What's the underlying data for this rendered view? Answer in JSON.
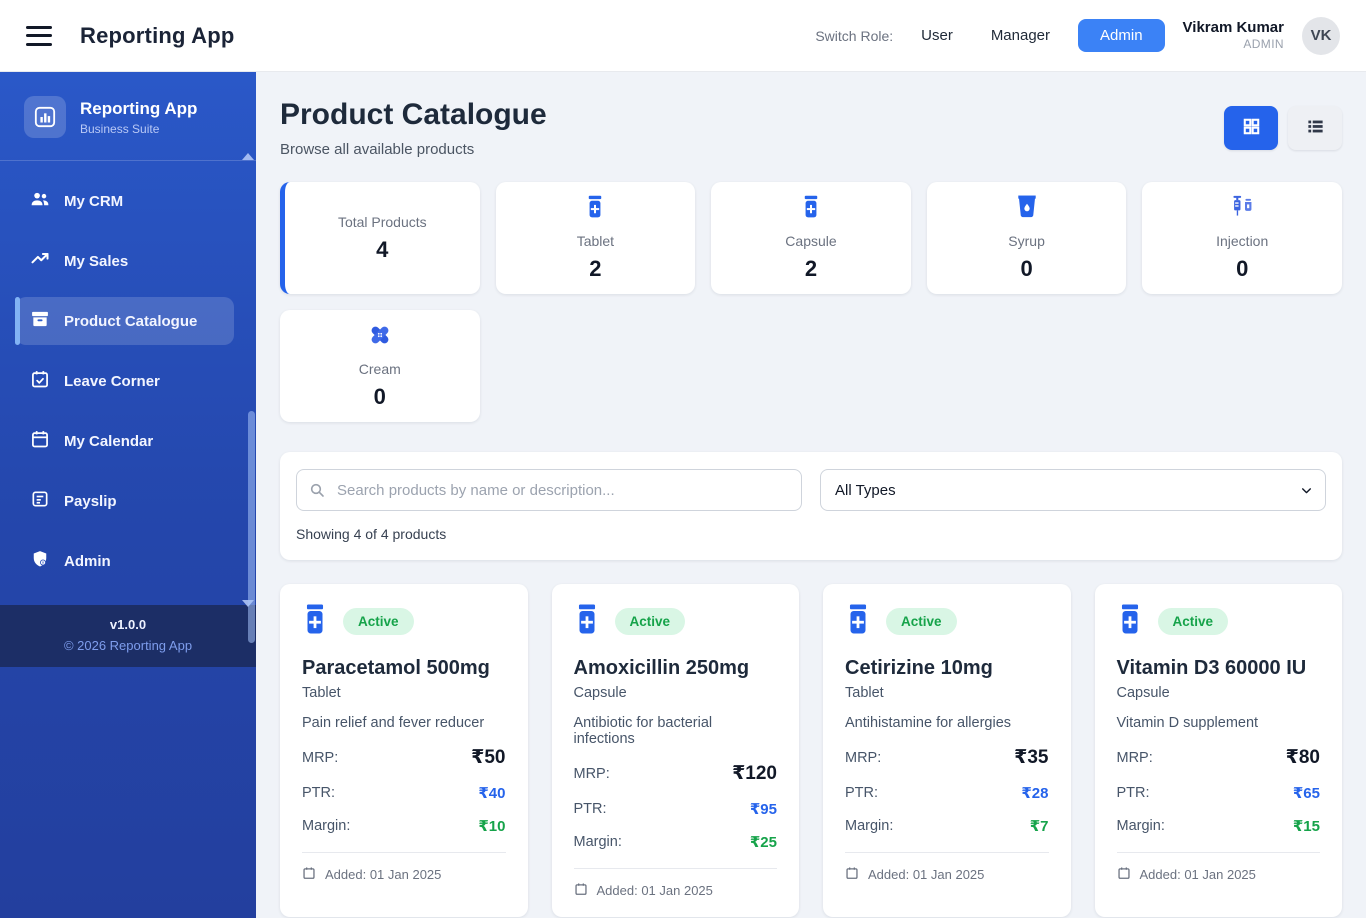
{
  "header": {
    "app_title": "Reporting App",
    "switch_role_label": "Switch Role:",
    "roles": [
      {
        "label": "User",
        "active": false
      },
      {
        "label": "Manager",
        "active": false
      },
      {
        "label": "Admin",
        "active": true
      }
    ],
    "user": {
      "name": "Vikram Kumar",
      "role": "ADMIN",
      "initials": "VK"
    }
  },
  "sidebar": {
    "brand": {
      "title": "Reporting App",
      "subtitle": "Business Suite",
      "logo_icon": "bar-chart-icon"
    },
    "items": [
      {
        "label": "My CRM",
        "icon": "users-icon",
        "active": false
      },
      {
        "label": "My Sales",
        "icon": "trending-up-icon",
        "active": false
      },
      {
        "label": "Product Catalogue",
        "icon": "archive-box-icon",
        "active": true
      },
      {
        "label": "Leave Corner",
        "icon": "calendar-check-icon",
        "active": false
      },
      {
        "label": "My Calendar",
        "icon": "calendar-icon",
        "active": false
      },
      {
        "label": "Payslip",
        "icon": "receipt-icon",
        "active": false
      },
      {
        "label": "Admin",
        "icon": "admin-shield-icon",
        "active": false
      }
    ],
    "footer": {
      "version": "v1.0.0",
      "copyright": "© 2026 Reporting App"
    }
  },
  "page": {
    "title": "Product Catalogue",
    "subtitle": "Browse all available products",
    "view_modes": [
      "grid",
      "list"
    ],
    "active_view": "grid"
  },
  "stats": [
    {
      "label": "Total Products",
      "value": "4",
      "icon": null,
      "selected": true
    },
    {
      "label": "Tablet",
      "value": "2",
      "icon": "pill-bottle-icon"
    },
    {
      "label": "Capsule",
      "value": "2",
      "icon": "pill-bottle-icon"
    },
    {
      "label": "Syrup",
      "value": "0",
      "icon": "syrup-cup-icon"
    },
    {
      "label": "Injection",
      "value": "0",
      "icon": "syringe-icon"
    },
    {
      "label": "Cream",
      "value": "0",
      "icon": "bandage-icon"
    }
  ],
  "filters": {
    "search_placeholder": "Search products by name or description...",
    "type_filter_value": "All Types",
    "results_text": "Showing 4 of 4 products"
  },
  "labels": {
    "mrp": "MRP:",
    "ptr": "PTR:",
    "margin": "Margin:"
  },
  "products": [
    {
      "name": "Paracetamol 500mg",
      "type": "Tablet",
      "description": "Pain relief and fever reducer",
      "status": "Active",
      "mrp": "₹50",
      "ptr": "₹40",
      "margin": "₹10",
      "added": "Added: 01 Jan 2025"
    },
    {
      "name": "Amoxicillin 250mg",
      "type": "Capsule",
      "description": "Antibiotic for bacterial infections",
      "status": "Active",
      "mrp": "₹120",
      "ptr": "₹95",
      "margin": "₹25",
      "added": "Added: 01 Jan 2025"
    },
    {
      "name": "Cetirizine 10mg",
      "type": "Tablet",
      "description": "Antihistamine for allergies",
      "status": "Active",
      "mrp": "₹35",
      "ptr": "₹28",
      "margin": "₹7",
      "added": "Added: 01 Jan 2025"
    },
    {
      "name": "Vitamin D3 60000 IU",
      "type": "Capsule",
      "description": "Vitamin D supplement",
      "status": "Active",
      "mrp": "₹80",
      "ptr": "₹65",
      "margin": "₹15",
      "added": "Added: 01 Jan 2025"
    }
  ],
  "colors": {
    "accent_blue": "#2563eb",
    "role_button_blue": "#3b82f6",
    "sidebar_top": "#2a58c8",
    "sidebar_bottom": "#233f9e",
    "sidebar_footer": "#1c2e66",
    "badge_green_bg": "#d9f6e5",
    "badge_green_text": "#16a34a",
    "ptr_blue": "#2563eb",
    "margin_green": "#16a34a"
  }
}
